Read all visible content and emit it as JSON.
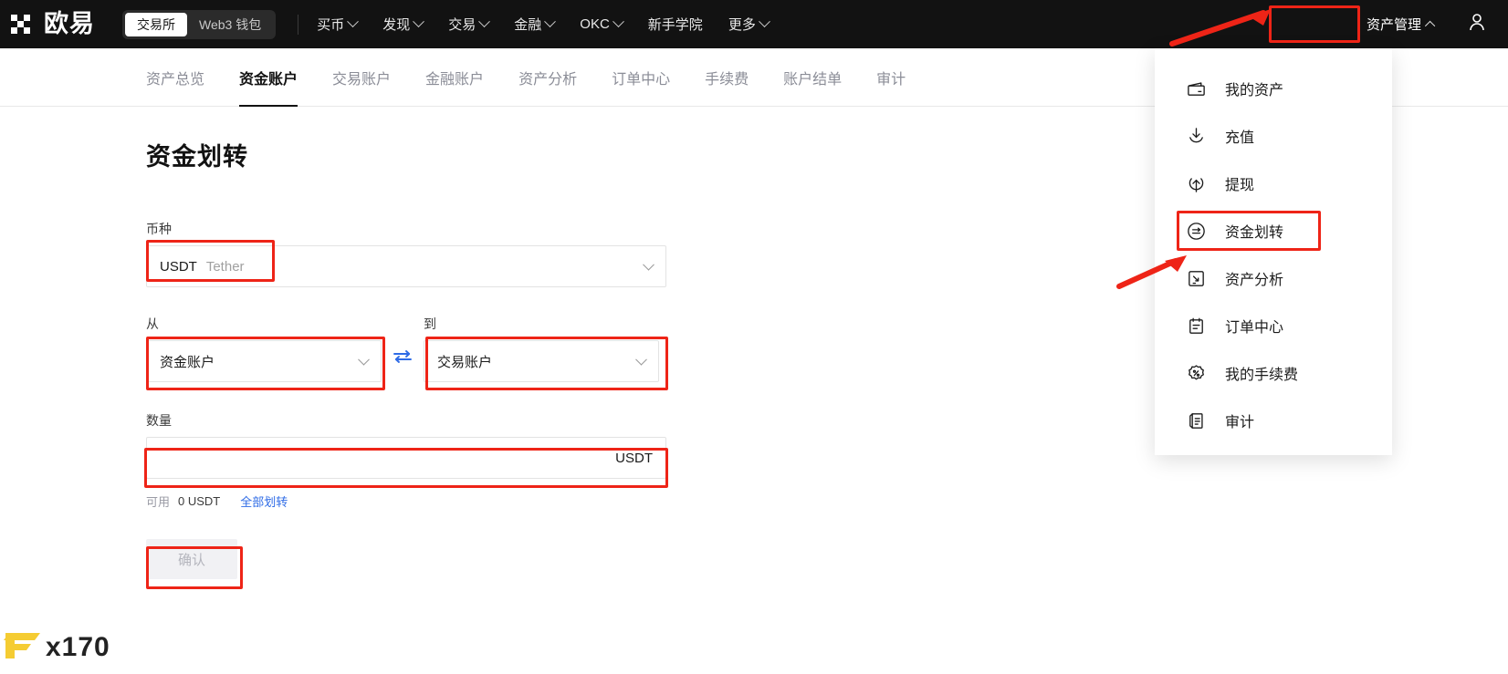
{
  "brand": {
    "name": "欧易",
    "logo_icon": "okx-logo-icon"
  },
  "header": {
    "segments": [
      {
        "label": "交易所",
        "active": true
      },
      {
        "label": "Web3 钱包",
        "active": false
      }
    ],
    "nav_links": [
      {
        "label": "买币",
        "has_caret": true
      },
      {
        "label": "发现",
        "has_caret": true
      },
      {
        "label": "交易",
        "has_caret": true
      },
      {
        "label": "金融",
        "has_caret": true
      },
      {
        "label": "OKC",
        "has_caret": true
      },
      {
        "label": "新手学院",
        "has_caret": false
      },
      {
        "label": "更多",
        "has_caret": true
      }
    ],
    "asset_manager": {
      "label": "资产管理",
      "caret_icon": "chevron-up-icon"
    },
    "user_icon": "user-avatar-icon"
  },
  "subnav": {
    "items": [
      {
        "label": "资产总览",
        "active": false
      },
      {
        "label": "资金账户",
        "active": true
      },
      {
        "label": "交易账户",
        "active": false
      },
      {
        "label": "金融账户",
        "active": false
      },
      {
        "label": "资产分析",
        "active": false
      },
      {
        "label": "订单中心",
        "active": false
      },
      {
        "label": "手续费",
        "active": false
      },
      {
        "label": "账户结单",
        "active": false
      },
      {
        "label": "审计",
        "active": false
      }
    ]
  },
  "form": {
    "title": "资金划转",
    "currency": {
      "label": "币种",
      "symbol": "USDT",
      "full_name": "Tether",
      "chevron_icon": "chevron-down-icon"
    },
    "from": {
      "label": "从",
      "value": "资金账户",
      "chevron_icon": "chevron-down-icon"
    },
    "swap_icon": "swap-arrows-icon",
    "to": {
      "label": "到",
      "value": "交易账户",
      "chevron_icon": "chevron-down-icon"
    },
    "amount": {
      "label": "数量",
      "value": "",
      "placeholder": "",
      "suffix": "USDT"
    },
    "available": {
      "label": "可用",
      "value": "0 USDT",
      "all_link": "全部划转"
    },
    "confirm_label": "确认"
  },
  "dropdown": {
    "items": [
      {
        "label": "我的资产",
        "icon": "wallet-icon",
        "highlighted": false
      },
      {
        "label": "充值",
        "icon": "deposit-down-arrow-icon",
        "highlighted": false
      },
      {
        "label": "提现",
        "icon": "withdraw-up-arrow-icon",
        "highlighted": false
      },
      {
        "label": "资金划转",
        "icon": "transfer-circle-icon",
        "highlighted": true
      },
      {
        "label": "资产分析",
        "icon": "analysis-square-icon",
        "highlighted": false
      },
      {
        "label": "订单中心",
        "icon": "order-clipboard-icon",
        "highlighted": false
      },
      {
        "label": "我的手续费",
        "icon": "fee-percent-badge-icon",
        "highlighted": false
      },
      {
        "label": "审计",
        "icon": "audit-document-icon",
        "highlighted": false
      }
    ]
  },
  "watermark": {
    "text": "x170",
    "logo_icon": "f-logo-icon"
  },
  "colors": {
    "accent_red": "#ee2417",
    "link_blue": "#2e6be6",
    "nav_bg": "#121212",
    "swap_blue": "#2e6be6",
    "watermark_yellow": "#f5cc32"
  }
}
